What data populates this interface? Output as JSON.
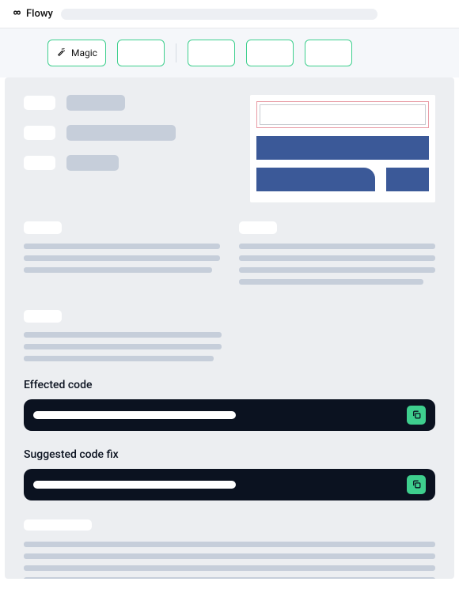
{
  "header": {
    "logo_text": "Flowy"
  },
  "toolbar": {
    "magic_label": "Magic"
  },
  "code": {
    "effected_heading": "Effected code",
    "suggested_heading": "Suggested code fix"
  }
}
